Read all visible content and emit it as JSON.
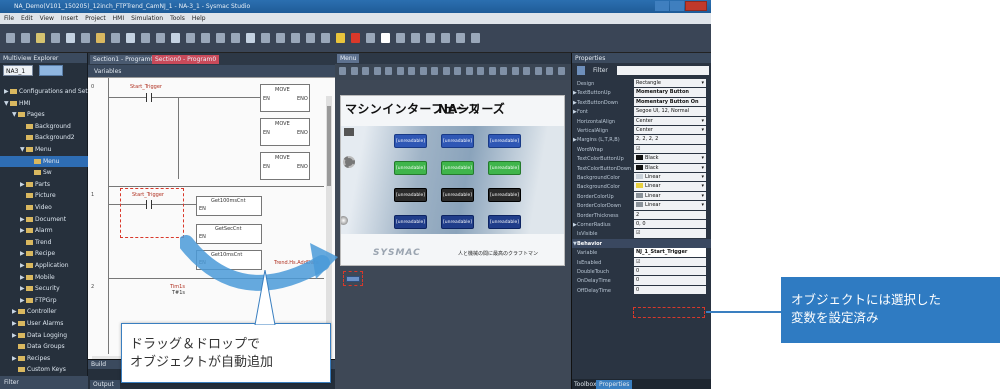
{
  "window": {
    "title": "NA_Demo(V101_150205)_12inch_FTPTrend_CamNJ_1 - NA-3_1 - Sysmac Studio"
  },
  "menu": [
    "File",
    "Edit",
    "View",
    "Insert",
    "Project",
    "HMI",
    "Simulation",
    "Tools",
    "Help"
  ],
  "multiview": {
    "title": "Multiview Explorer",
    "device": "NA3_1",
    "items": [
      {
        "label": "Configurations and Setup",
        "indent": 0,
        "arrow": "▶"
      },
      {
        "label": "HMI",
        "indent": 0,
        "arrow": "▼"
      },
      {
        "label": "Pages",
        "indent": 1,
        "arrow": "▼"
      },
      {
        "label": "Background",
        "indent": 2,
        "arrow": ""
      },
      {
        "label": "Background2",
        "indent": 2,
        "arrow": ""
      },
      {
        "label": "Menu",
        "indent": 2,
        "arrow": "▼"
      },
      {
        "label": "Menu",
        "indent": 3,
        "arrow": "",
        "selected": true
      },
      {
        "label": "Sw",
        "indent": 3,
        "arrow": ""
      },
      {
        "label": "Parts",
        "indent": 2,
        "arrow": "▶"
      },
      {
        "label": "Picture",
        "indent": 2,
        "arrow": ""
      },
      {
        "label": "Video",
        "indent": 2,
        "arrow": ""
      },
      {
        "label": "Document",
        "indent": 2,
        "arrow": "▶"
      },
      {
        "label": "Alarm",
        "indent": 2,
        "arrow": "▶"
      },
      {
        "label": "Trend",
        "indent": 2,
        "arrow": ""
      },
      {
        "label": "Recipe",
        "indent": 2,
        "arrow": "▶"
      },
      {
        "label": "Application",
        "indent": 2,
        "arrow": "▶"
      },
      {
        "label": "Mobile",
        "indent": 2,
        "arrow": "▶"
      },
      {
        "label": "Security",
        "indent": 2,
        "arrow": "▶"
      },
      {
        "label": "FTPGrp",
        "indent": 2,
        "arrow": "▶"
      },
      {
        "label": "Controller",
        "indent": 1,
        "arrow": "▶"
      },
      {
        "label": "User Alarms",
        "indent": 1,
        "arrow": "▶"
      },
      {
        "label": "Data Logging",
        "indent": 1,
        "arrow": "▶"
      },
      {
        "label": "Data Groups",
        "indent": 1,
        "arrow": ""
      },
      {
        "label": "Recipes",
        "indent": 1,
        "arrow": "▶"
      },
      {
        "label": "Custom Keys",
        "indent": 1,
        "arrow": ""
      }
    ],
    "filter": "Filter"
  },
  "center": {
    "tabs": [
      "Section1 - Program0",
      "Section0 - Program0"
    ],
    "variables_label": "Variables",
    "rungs": [
      {
        "number": "0",
        "contact": "Start_Trigger"
      },
      {
        "number": "1",
        "contact": "Start_Trigger"
      },
      {
        "number": "2",
        "contact": "Tim1s"
      }
    ],
    "blocks": [
      {
        "label": "MOVE",
        "in": "EN",
        "out": "ENO"
      },
      {
        "label": "MOVE",
        "in": "EN",
        "out": "ENO"
      },
      {
        "label": "MOVE",
        "in": "EN",
        "out": "ENO"
      },
      {
        "label": "Get100msCnt",
        "in": "EN",
        "out": ""
      },
      {
        "label": "GetSecCnt",
        "in": "EN",
        "out": ""
      },
      {
        "label": "Get10msCnt",
        "in": "EN",
        "out": ""
      }
    ],
    "coil_label": "Trend.Hs.AddData",
    "rung2_value": "T#1s",
    "build_label": "Build",
    "output_tab": "Output"
  },
  "menu_panel": {
    "tab": "Menu",
    "page_title": "マシンインターフェース",
    "page_brand": "NAシリーズ",
    "logo": "SYSMAC",
    "description": "人と機械の間に最高のクラフトマン",
    "buttons": [
      {
        "label": "[unreadable]",
        "style": "blue"
      },
      {
        "label": "[unreadable]",
        "style": "blue"
      },
      {
        "label": "[unreadable]",
        "style": "blue"
      },
      {
        "label": "[unreadable]",
        "style": "green"
      },
      {
        "label": "[unreadable]",
        "style": "green"
      },
      {
        "label": "[unreadable]",
        "style": "green"
      },
      {
        "label": "[unreadable]",
        "style": "dark"
      },
      {
        "label": "[unreadable]",
        "style": "dark"
      },
      {
        "label": "[unreadable]",
        "style": "dark"
      },
      {
        "label": "[unreadable]",
        "style": "navy"
      },
      {
        "label": "[unreadable]",
        "style": "navy"
      },
      {
        "label": "[unreadable]",
        "style": "navy"
      }
    ]
  },
  "properties": {
    "title": "Properties",
    "filter": "Filter",
    "rows": [
      {
        "name": "Design",
        "value": "Rectangle",
        "dropdown": true
      },
      {
        "name": "TextButtonUp",
        "value": "Momentary Button",
        "bold": true,
        "expander": "▶"
      },
      {
        "name": "TextButtonDown",
        "value": "Momentary Button On",
        "bold": true,
        "expander": "▶"
      },
      {
        "name": "Font",
        "value": "Segoe UI, 12, Normal",
        "expander": "▶"
      },
      {
        "name": "HorizontalAlign",
        "value": "Center",
        "dropdown": true
      },
      {
        "name": "VerticalAlign",
        "value": "Center",
        "dropdown": true
      },
      {
        "name": "Margins (L,T,R,B)",
        "value": "2, 2, 2, 2",
        "expander": "▶"
      },
      {
        "name": "WordWrap",
        "value": "☑"
      },
      {
        "name": "TextColorButtonUp",
        "value": "Black",
        "swatch": "#111111",
        "dropdown": true
      },
      {
        "name": "TextColorButtonDown",
        "value": "Black",
        "swatch": "#111111",
        "dropdown": true
      },
      {
        "name": "BackgroundColor",
        "value": "Linear",
        "swatch": "#c8d0d8",
        "dropdown": true
      },
      {
        "name": "BackgroundColor",
        "value": "Linear",
        "swatch": "#e8d040",
        "dropdown": true
      },
      {
        "name": "BorderColorUp",
        "value": "Linear",
        "swatch": "#8a929a",
        "dropdown": true
      },
      {
        "name": "BorderColorDown",
        "value": "Linear",
        "swatch": "#8a929a",
        "dropdown": true
      },
      {
        "name": "BorderThickness",
        "value": "2"
      },
      {
        "name": "CornerRadius",
        "value": "0, 0",
        "expander": "▶"
      },
      {
        "name": "IsVisible",
        "value": "☑"
      },
      {
        "name": "Behavior",
        "value": "",
        "section": true,
        "expander": "▼"
      },
      {
        "name": "Variable",
        "value": "NJ_1_Start_Trigger",
        "bold": true,
        "highlight": true
      },
      {
        "name": "IsEnabled",
        "value": "☑"
      },
      {
        "name": "DoubleTouch",
        "value": "0"
      },
      {
        "name": "OnDelayTime",
        "value": "0"
      },
      {
        "name": "OffDelayTime",
        "value": "0"
      }
    ],
    "bottom_tabs": [
      "Toolbox",
      "Properties"
    ]
  },
  "callouts": {
    "drag_drop_line1": "ドラッグ＆ドロップで",
    "drag_drop_line2": "オブジェクトが自動追加",
    "variable_line1": "オブジェクトには選択した",
    "variable_line2": "変数を設定済み"
  },
  "colors": {
    "accent": "#2f7bc2",
    "highlight": "#d9382a",
    "arrow": "#4a9ad8"
  }
}
